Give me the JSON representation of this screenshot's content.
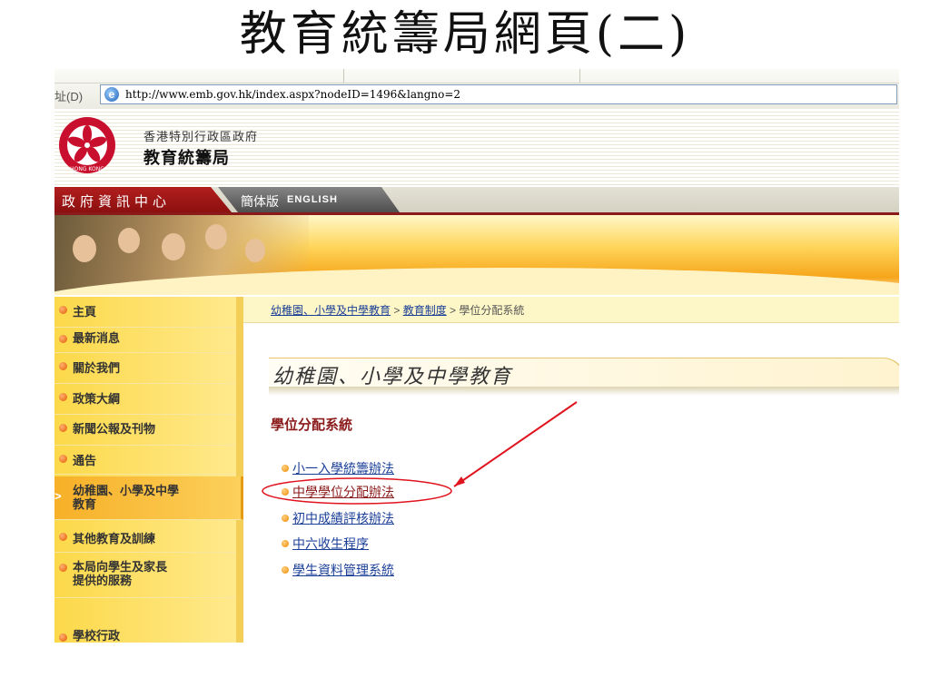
{
  "slide": {
    "title": "教育統籌局網頁(二)"
  },
  "browser": {
    "address_label": "址(D)",
    "url": "http://www.emb.gov.hk/index.aspx?nodeID=1496&langno=2"
  },
  "header": {
    "org_line1": "香港特別行政區政府",
    "org_line2": "教育統籌局",
    "emblem_text": "HONG KONG"
  },
  "nav": {
    "info_centre": "政府資訊中心",
    "simplified": "簡体版",
    "english": "ENGLISH"
  },
  "breadcrumb": {
    "item1": "幼稚園、小學及中學教育",
    "sep": " > ",
    "item2": "教育制度",
    "current": "學位分配系統"
  },
  "sidebar": {
    "items": [
      {
        "label": "主頁"
      },
      {
        "label": "最新消息"
      },
      {
        "label": "關於我們"
      },
      {
        "label": "政策大綱"
      },
      {
        "label": "新聞公報及刊物"
      },
      {
        "label": "通告"
      },
      {
        "label_line1": "幼稚園、小學及中學",
        "label_line2": "教育"
      },
      {
        "label": "其他教育及訓練"
      },
      {
        "label_line1": "本局向學生及家長",
        "label_line2": "提供的服務"
      },
      {
        "label": "學校行政"
      }
    ]
  },
  "main": {
    "section_title": "幼稚園、小學及中學教育",
    "heading": "學位分配系統",
    "links": [
      {
        "label": "小一入學統籌辦法"
      },
      {
        "label": "中學學位分配辦法"
      },
      {
        "label": "初中成績評核辦法"
      },
      {
        "label": "中六收生程序"
      },
      {
        "label": "學生資料管理系統"
      }
    ]
  },
  "colors": {
    "annotation_red": "#e0141e",
    "nav_red": "#8c1010",
    "link_blue": "#1b3f98",
    "sidebar_yellow": "#fcd94a"
  }
}
